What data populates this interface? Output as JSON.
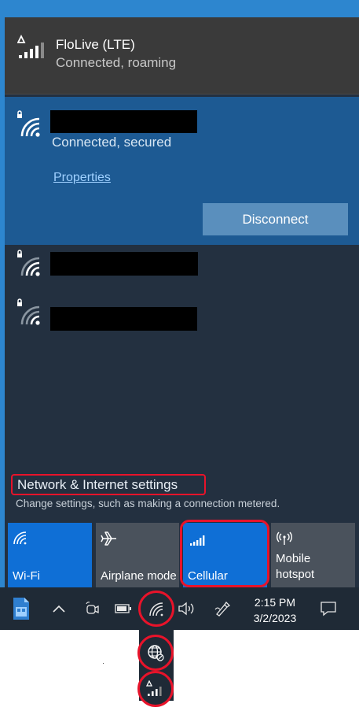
{
  "cellular": {
    "name": "FloLive (LTE)",
    "status": "Connected, roaming"
  },
  "wifi": {
    "active": {
      "status": "Connected, secured",
      "properties_label": "Properties",
      "disconnect_label": "Disconnect"
    }
  },
  "settings": {
    "title": "Network & Internet settings",
    "subtitle": "Change settings, such as making a connection metered."
  },
  "quick_actions": [
    {
      "label": "Wi-Fi",
      "icon": "wifi-icon",
      "state": "on"
    },
    {
      "label": "Airplane mode",
      "icon": "airplane-icon",
      "state": "off"
    },
    {
      "label": "Cellular",
      "icon": "cellular-signal-icon",
      "state": "on"
    },
    {
      "label": "Mobile\nhotspot",
      "icon": "hotspot-icon",
      "state": "off"
    }
  ],
  "taskbar": {
    "time": "2:15 PM",
    "date": "3/2/2023"
  },
  "colors": {
    "accent": "#0f6fd6",
    "highlight_ring": "#e8132a",
    "flyout_bg": "#233040"
  }
}
